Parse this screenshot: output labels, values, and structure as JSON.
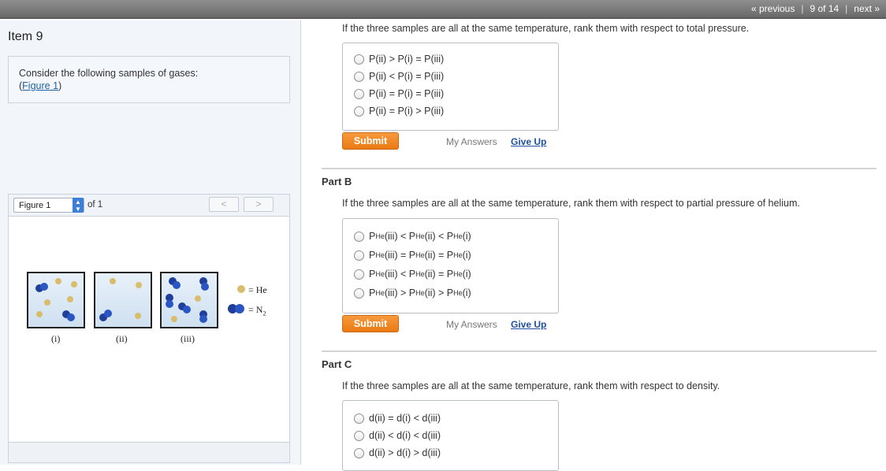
{
  "topnav": {
    "previous": "« previous",
    "position": "9 of 14",
    "next": "next »"
  },
  "left": {
    "item_title": "Item 9",
    "intro_text": "Consider the following samples of gases:",
    "figure_link_open": "(",
    "figure_link": "Figure 1",
    "figure_link_close": ")",
    "figure_select": "Figure 1",
    "figure_of": "of 1",
    "prev_label": "<",
    "next_label": ">"
  },
  "figure": {
    "samples": [
      "(i)",
      "(ii)",
      "(iii)"
    ],
    "legend_he": "= He",
    "legend_n2": "= N",
    "legend_n2_sub": "2",
    "colors": {
      "helium": "#d8be6c",
      "nitrogen": "#1f3f9a"
    }
  },
  "partA": {
    "prompt": "If the three samples are all at the same temperature, rank them with respect to total pressure.",
    "choices": [
      "P(ii) > P(i) = P(iii)",
      "P(ii) < P(i) = P(iii)",
      "P(ii) = P(i) = P(iii)",
      "P(ii) = P(i) > P(iii)"
    ]
  },
  "partB": {
    "title": "Part B",
    "prompt": "If the three samples are all at the same temperature, rank them with respect to partial pressure of helium.",
    "sub": "He",
    "choices": [
      [
        "P",
        "(iii) < P",
        "(ii) < P",
        "(i)"
      ],
      [
        "P",
        "(iii) = P",
        "(ii) = P",
        "(i)"
      ],
      [
        "P",
        "(iii) < P",
        "(ii) = P",
        "(i)"
      ],
      [
        "P",
        "(iii) > P",
        "(ii) > P",
        "(i)"
      ]
    ]
  },
  "partC": {
    "title": "Part C",
    "prompt": "If the three samples are all at the same temperature, rank them with respect to density.",
    "choices": [
      "d(ii) = d(i) < d(iii)",
      "d(ii) < d(i) < d(iii)",
      "d(ii) > d(i) > d(iii)"
    ]
  },
  "actions": {
    "submit": "Submit",
    "my_answers": "My Answers",
    "give_up": "Give Up"
  }
}
